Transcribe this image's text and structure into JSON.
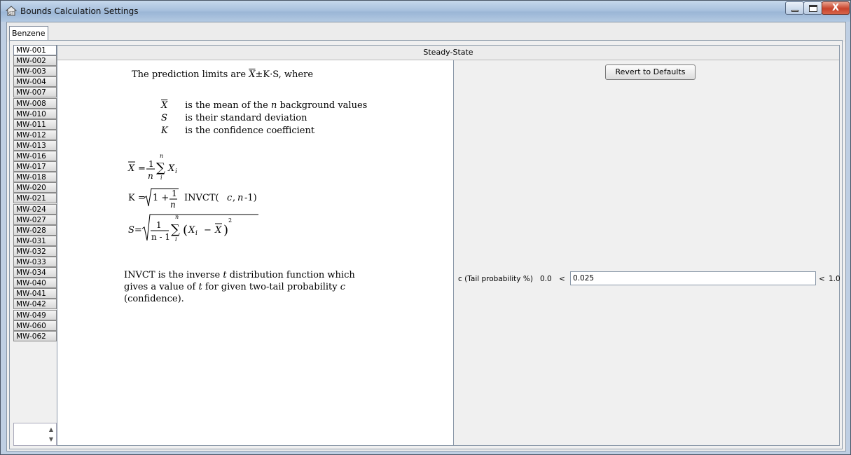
{
  "window": {
    "title": "Bounds Calculation Settings",
    "controls": {
      "minimize": "minimize",
      "maximize": "maximize",
      "close": "X"
    }
  },
  "tabs": {
    "chemical": "Benzene"
  },
  "wells": [
    "MW-001",
    "MW-002",
    "MW-003",
    "MW-004",
    "MW-007",
    "MW-008",
    "MW-010",
    "MW-011",
    "MW-012",
    "MW-013",
    "MW-016",
    "MW-017",
    "MW-018",
    "MW-020",
    "MW-021",
    "MW-024",
    "MW-027",
    "MW-028",
    "MW-031",
    "MW-032",
    "MW-033",
    "MW-034",
    "MW-040",
    "MW-041",
    "MW-042",
    "MW-049",
    "MW-060",
    "MW-062"
  ],
  "selected_well": "MW-001",
  "panel": {
    "header": "Steady-State",
    "description": {
      "intro_prefix": "The prediction limits are",
      "intro_X": "X",
      "intro_mid": "±K·S, where",
      "defs": [
        {
          "symbol": "X",
          "text_pre": "is the mean of the",
          "n": "n",
          "text_post": "background values"
        },
        {
          "symbol": "S",
          "text": "is their standard deviation"
        },
        {
          "symbol": "K",
          "text": "is the confidence coefficient"
        }
      ],
      "formula_mean": {
        "lhs": "X",
        "eq": "=",
        "num": "1",
        "den": "n",
        "sum_top": "n",
        "sum_bot": "i",
        "term": "X",
        "sub": "i"
      },
      "formula_k": {
        "lhs": "K =",
        "one": "1 +",
        "num": "1",
        "den": "n",
        "func": "INVCT(",
        "c": "c",
        "comma": ",",
        "n": "n",
        "tail": "-1)"
      },
      "formula_s": {
        "lhs": "S=",
        "num": "1",
        "den": "n - 1",
        "sum_top": "n",
        "sum_bot": "i",
        "open": "(",
        "X": "X",
        "sub": "i",
        "minus": "−",
        "Xbar": "X",
        "close": ")",
        "sq": "2"
      },
      "note_l1_pre": "INVCT is the inverse",
      "note_l1_t": "t",
      "note_l1_post": "distribution function which",
      "note_l2_pre": "gives a value of",
      "note_l2_t": "t",
      "note_l2_post": "for given two-tail probability",
      "note_l2_c": "c",
      "note_l3": "(confidence)."
    },
    "settings": {
      "revert_label": "Revert to Defaults",
      "param_label": "c (Tail probability %)",
      "min": "0.0",
      "lt": "<",
      "value": "0.025",
      "max": "1.0"
    }
  }
}
